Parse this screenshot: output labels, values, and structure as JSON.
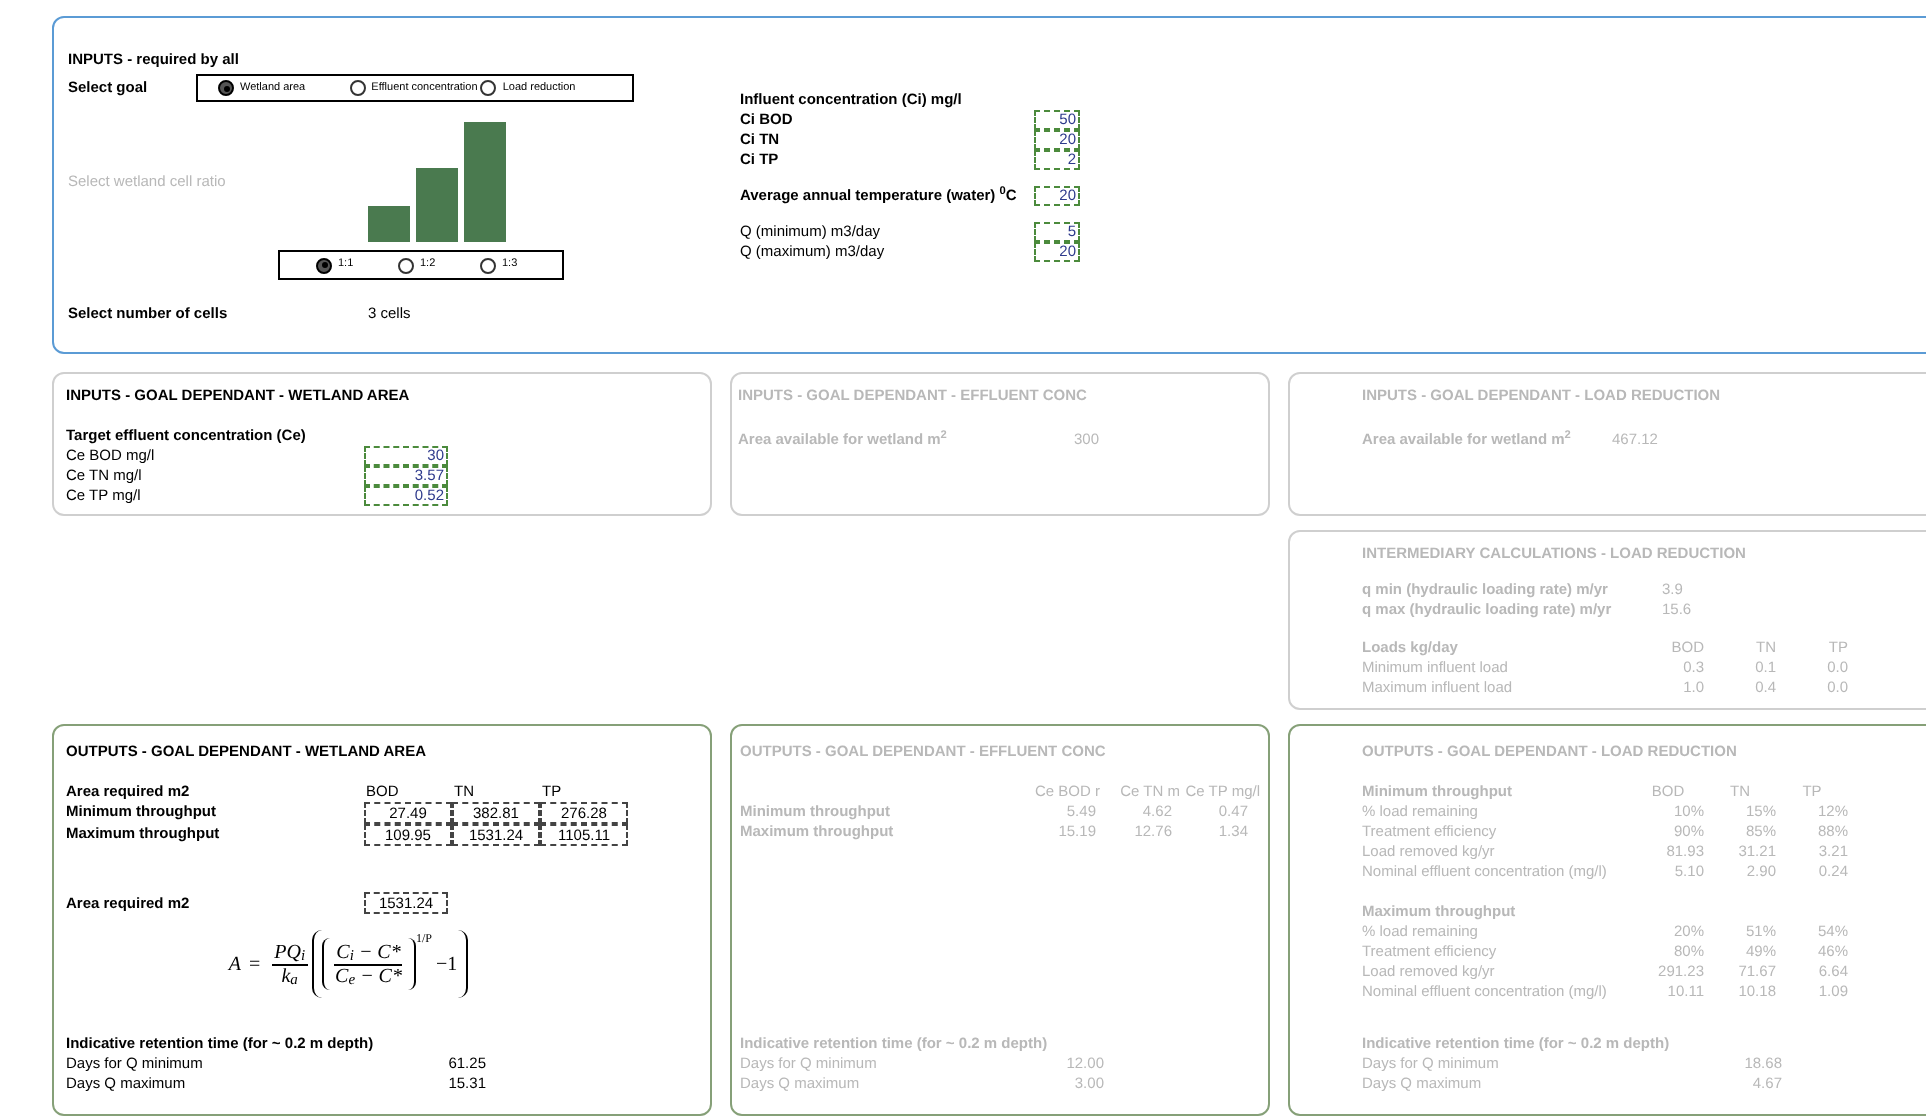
{
  "inputs_all": {
    "kind": "main",
    "disabled": false,
    "title": "INPUTS - required by all",
    "goal_label": "Select goal",
    "goal_options": [
      {
        "label": "Wetland area",
        "selected": true
      },
      {
        "label": "Effluent concentration",
        "selected": false
      },
      {
        "label": "Load reduction",
        "selected": false
      }
    ],
    "ratio_label": {
      "text": "Select wetland cell ratio",
      "disabled": true
    },
    "ratio_options": [
      {
        "label": "1:1",
        "selected": true
      },
      {
        "label": "1:2",
        "selected": false
      },
      {
        "label": "1:3",
        "selected": false
      }
    ],
    "cells_label": "Select number of cells",
    "cells_value": "3 cells",
    "influent_title": "Influent concentration (Ci) mg/l",
    "influent": [
      {
        "label": "Ci BOD",
        "value": "50"
      },
      {
        "label": "Ci TN",
        "value": "20"
      },
      {
        "label": "Ci TP",
        "value": "2"
      }
    ],
    "temperature": {
      "label": "Average annual temperature (water) $^{0}$C",
      "value": "20"
    },
    "flows": [
      {
        "label": "Q (minimum) m3/day",
        "value": "5"
      },
      {
        "label": "Q (maximum) m3/day",
        "value": "20"
      }
    ]
  },
  "inputs_wetland_area": {
    "kind": "input",
    "disabled": false,
    "title": "INPUTS - GOAL DEPENDANT - WETLAND AREA",
    "subtitle": "Target effluent concentration (Ce)",
    "fields": [
      {
        "label": "Ce BOD mg/l",
        "value": "30"
      },
      {
        "label": "Ce TN mg/l",
        "value": "3.57"
      },
      {
        "label": "Ce TP mg/l",
        "value": "0.52"
      }
    ]
  },
  "inputs_effluent_conc": {
    "kind": "input",
    "disabled": true,
    "title": "INPUTS - GOAL DEPENDANT - EFFLUENT CONC",
    "label": "Area available for wetland m$^{2}$",
    "value": "300"
  },
  "inputs_load_reduction": {
    "kind": "input",
    "disabled": true,
    "title": "INPUTS - GOAL DEPENDANT - LOAD REDUCTION",
    "label": "Area available for wetland m$^{2}$",
    "value": "467.12"
  },
  "intermediary": {
    "kind": "input",
    "disabled": true,
    "title": "INTERMEDIARY CALCULATIONS  - LOAD REDUCTION",
    "rates": [
      {
        "label": "q min (hydraulic loading rate) m/yr",
        "value": "3.9"
      },
      {
        "label": "q max (hydraulic loading rate) m/yr",
        "value": "15.6"
      }
    ],
    "loads_title": "Loads kg/day",
    "columns": [
      "BOD",
      "TN",
      "TP"
    ],
    "rows": [
      {
        "label": "Minimum influent load",
        "values": [
          "0.3",
          "0.1",
          "0.0"
        ]
      },
      {
        "label": "Maximum influent load",
        "values": [
          "1.0",
          "0.4",
          "0.0"
        ]
      }
    ]
  },
  "outputs_wetland_area": {
    "kind": "output",
    "disabled": false,
    "title": "OUTPUTS - GOAL DEPENDANT - WETLAND AREA",
    "area_label": "Area required m2",
    "columns": [
      "BOD",
      "TN",
      "TP"
    ],
    "rows": [
      {
        "label": "Minimum throughput",
        "values": [
          "27.49",
          "382.81",
          "276.28"
        ]
      },
      {
        "label": "Maximum throughput",
        "values": [
          "109.95",
          "1531.24",
          "1105.11"
        ]
      }
    ],
    "required_label": "Area required m2",
    "required_value": "1531.24",
    "formula": {
      "lhs": "A",
      "equals": "=",
      "numerator": "PQ$_{i}$",
      "denominator": "k$_{a}$",
      "inner_numerator": "C$_{i}$ − C*",
      "inner_denominator": "C$_{e}$ − C*",
      "exponent": "1/P",
      "tail": "−1"
    },
    "retention": {
      "title": "Indicative retention time (for ~ 0.2 m depth)",
      "rows": [
        {
          "label": "Days for Q minimum",
          "value": "61.25"
        },
        {
          "label": "Days Q maximum",
          "value": "15.31"
        }
      ]
    }
  },
  "outputs_effluent_conc": {
    "kind": "output",
    "disabled": true,
    "title": "OUTPUTS - GOAL DEPENDANT - EFFLUENT CONC",
    "columns": [
      "Ce BOD r",
      "Ce TN m",
      "Ce TP mg/l"
    ],
    "rows": [
      {
        "label": "Minimum throughput",
        "values": [
          "5.49",
          "4.62",
          "0.47"
        ]
      },
      {
        "label": "Maximum throughput",
        "values": [
          "15.19",
          "12.76",
          "1.34"
        ]
      }
    ],
    "retention": {
      "title": "Indicative retention time (for ~ 0.2 m depth)",
      "rows": [
        {
          "label": "Days for Q minimum",
          "value": "12.00"
        },
        {
          "label": "Days Q maximum",
          "value": "3.00"
        }
      ]
    }
  },
  "outputs_load_reduction": {
    "kind": "output",
    "disabled": true,
    "title": "OUTPUTS - GOAL DEPENDANT - LOAD REDUCTION",
    "columns": [
      "BOD",
      "TN",
      "TP"
    ],
    "groups": [
      {
        "title": "Minimum throughput",
        "rows": [
          {
            "label": "% load remaining",
            "values": [
              "10%",
              "15%",
              "12%"
            ]
          },
          {
            "label": "Treatment efficiency",
            "values": [
              "90%",
              "85%",
              "88%"
            ]
          },
          {
            "label": "Load removed kg/yr",
            "values": [
              "81.93",
              "31.21",
              "3.21"
            ]
          },
          {
            "label": "Nominal effluent concentration (mg/l)",
            "values": [
              "5.10",
              "2.90",
              "0.24"
            ]
          }
        ]
      },
      {
        "title": "Maximum throughput",
        "rows": [
          {
            "label": "% load remaining",
            "values": [
              "20%",
              "51%",
              "54%"
            ]
          },
          {
            "label": "Treatment efficiency",
            "values": [
              "80%",
              "49%",
              "46%"
            ]
          },
          {
            "label": "Load removed kg/yr",
            "values": [
              "291.23",
              "71.67",
              "6.64"
            ]
          },
          {
            "label": "Nominal effluent concentration (mg/l)",
            "values": [
              "10.11",
              "10.18",
              "1.09"
            ]
          }
        ]
      }
    ],
    "retention": {
      "title": "Indicative retention time (for ~ 0.2 m depth)",
      "rows": [
        {
          "label": "Days for Q minimum",
          "value": "18.68"
        },
        {
          "label": "Days Q maximum",
          "value": "4.67"
        }
      ]
    }
  }
}
